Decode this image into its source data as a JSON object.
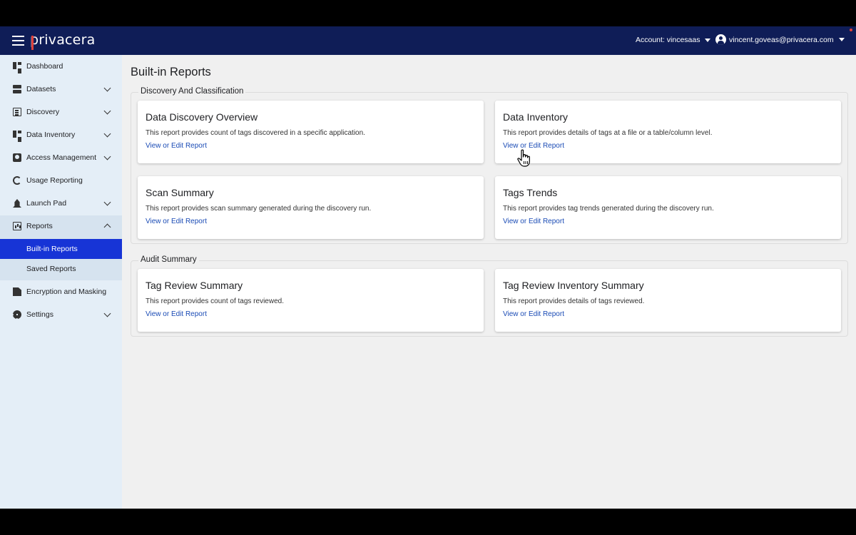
{
  "header": {
    "logo": "privacera",
    "account_label": "Account: vincesaas",
    "user_email": "vincent.goveas@privacera.com"
  },
  "sidebar": {
    "items": [
      {
        "label": "Dashboard",
        "icon": "dashboard-icon",
        "expandable": false
      },
      {
        "label": "Datasets",
        "icon": "datasets-icon",
        "expandable": true
      },
      {
        "label": "Discovery",
        "icon": "discovery-icon",
        "expandable": true
      },
      {
        "label": "Data Inventory",
        "icon": "data-inventory-icon",
        "expandable": true
      },
      {
        "label": "Access Management",
        "icon": "access-management-icon",
        "expandable": true
      },
      {
        "label": "Usage Reporting",
        "icon": "usage-reporting-icon",
        "expandable": false
      },
      {
        "label": "Launch Pad",
        "icon": "launch-pad-icon",
        "expandable": true
      },
      {
        "label": "Reports",
        "icon": "reports-icon",
        "expandable": true,
        "expanded": true
      },
      {
        "label": "Encryption and Masking",
        "icon": "encryption-icon",
        "expandable": false
      },
      {
        "label": "Settings",
        "icon": "settings-icon",
        "expandable": true
      }
    ],
    "reports_sub": [
      {
        "label": "Built-in Reports",
        "active": true
      },
      {
        "label": "Saved Reports",
        "active": false
      }
    ]
  },
  "main": {
    "title": "Built-in Reports",
    "groups": [
      {
        "label": "Discovery And Classification",
        "cards": [
          {
            "title": "Data Discovery Overview",
            "description": "This report provides count of tags discovered in a specific application.",
            "link": "View or Edit Report"
          },
          {
            "title": "Data Inventory",
            "description": "This report provides details of tags at a file or a table/column level.",
            "link": "View or Edit Report"
          },
          {
            "title": "Scan Summary",
            "description": "This report provides scan summary generated during the discovery run.",
            "link": "View or Edit Report"
          },
          {
            "title": "Tags Trends",
            "description": "This report provides tag trends generated during the discovery run.",
            "link": "View or Edit Report"
          }
        ]
      },
      {
        "label": "Audit Summary",
        "cards": [
          {
            "title": "Tag Review Summary",
            "description": "This report provides count of tags reviewed.",
            "link": "View or Edit Report"
          },
          {
            "title": "Tag Review Inventory Summary",
            "description": "This report provides details of tags reviewed.",
            "link": "View or Edit Report"
          }
        ]
      }
    ]
  },
  "colors": {
    "header_bg": "#0f1d57",
    "sidebar_bg": "#e4eef7",
    "active_item_bg": "#1734d6",
    "link": "#1a4bb5",
    "logo_accent": "#e0413b"
  }
}
